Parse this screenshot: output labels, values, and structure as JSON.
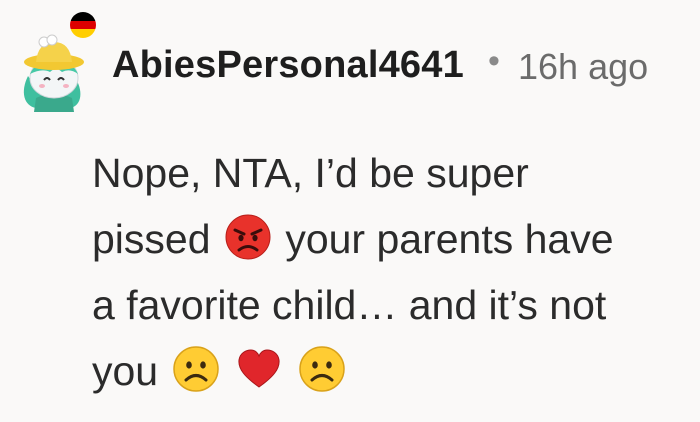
{
  "comment": {
    "author": {
      "username": "AbiesPersonal4641",
      "flag_icon": "germany-flag-icon",
      "avatar_icon": "snoo-avatar-icon"
    },
    "separator": "•",
    "timestamp": "16h ago",
    "body": {
      "line1": "Nope, NTA, I’d be super",
      "line2_a": "pissed",
      "line2_b": "your parents have",
      "line3": "a favorite child… and it’s not",
      "line4": "you"
    },
    "emojis": [
      "angry-face",
      "frowning-face",
      "red-heart",
      "frowning-face"
    ]
  },
  "colors": {
    "background": "#faf9f8",
    "text": "#2b2b2b",
    "username": "#1e1e1e",
    "meta": "#6b6b6b"
  }
}
